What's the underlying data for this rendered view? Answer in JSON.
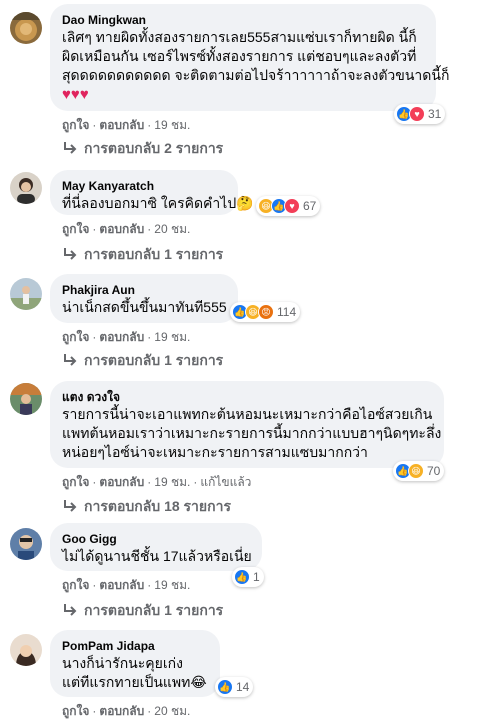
{
  "comments": [
    {
      "author": "Dao Mingkwan",
      "lines": [
        "เลิศๆ ทายผิดทั้งสองรายการเลย555สามแซ่บเราก็ทายผิด นี้ก็",
        "ผิดเหมือนกัน เซอร์ไพรซ์ทั้งสองรายการ แต่ชอบๆและลงตัวที่",
        "สุดดดดดดดดดดด จะติดตามต่อไปจร้าาาาาาถ้าจะลงตัวขนาดนี้ก็"
      ],
      "hearts": "♥♥♥",
      "reaction_count": "31",
      "reaction_icons": [
        "like-icon",
        "love-icon"
      ],
      "like": "ถูกใจ",
      "reply": "ตอบกลับ",
      "time": "19 ชม.",
      "edited": "",
      "replies": "การตอบกลับ 2 รายการ"
    },
    {
      "author": "May Kanyaratch",
      "lines": [
        "ที่นี่ลองบอกมาซิ ใครคิดคำไป🤔"
      ],
      "reaction_count": "67",
      "reaction_icons": [
        "haha-icon",
        "like-icon",
        "love-icon"
      ],
      "like": "ถูกใจ",
      "reply": "ตอบกลับ",
      "time": "20 ชม.",
      "replies": "การตอบกลับ 1 รายการ"
    },
    {
      "author": "Phakjira Aun",
      "lines": [
        "น่าเน็กสดขึ้นขึ้นมาทันที555"
      ],
      "reaction_count": "114",
      "reaction_icons": [
        "like-icon",
        "haha-icon",
        "angry-icon"
      ],
      "like": "ถูกใจ",
      "reply": "ตอบกลับ",
      "time": "19 ชม.",
      "replies": "การตอบกลับ 1 รายการ"
    },
    {
      "author": "แตง ดวงใจ",
      "lines": [
        "รายการนี้น่าจะเอาแพทกะต้นหอมนะเหมาะกว่าคือไอซ์สวยเกิน",
        "แพทต้นหอมเราว่าเหมาะกะรายการนี้มากกว่าแบบฮาๆนิดๆทะลึ่ง",
        "หน่อยๆไอซ์น่าจะเหมาะกะรายการสามแซบมากกว่า"
      ],
      "reaction_count": "70",
      "reaction_icons": [
        "like-icon",
        "haha-icon"
      ],
      "like": "ถูกใจ",
      "reply": "ตอบกลับ",
      "time": "19 ชม.",
      "edited": "แก้ไขแล้ว",
      "replies": "การตอบกลับ 18 รายการ"
    },
    {
      "author": "Goo Gigg",
      "lines": [
        "ไม่ได้ดูนานชีชั้น 17แล้วหรือเนี่ย"
      ],
      "reaction_count": "1",
      "reaction_icons": [
        "like-icon"
      ],
      "like": "ถูกใจ",
      "reply": "ตอบกลับ",
      "time": "19 ชม.",
      "replies": "การตอบกลับ 1 รายการ"
    },
    {
      "author": "PomPam Jidapa",
      "lines": [
        "นางก็น่ารักนะคุยเก่ง",
        "แต่ทีแรกทายเป็นแพท😂"
      ],
      "reaction_count": "14",
      "reaction_icons": [
        "like-icon"
      ],
      "like": "ถูกใจ",
      "reply": "ตอบกลับ",
      "time": "20 ชม."
    }
  ],
  "colors": {
    "bubble": "#f0f2f5",
    "meta_text": "#65676b",
    "like_blue": "#1877f2",
    "love_red": "#f33e58",
    "haha_yellow": "#f7b125",
    "angry_orange": "#e9710f"
  }
}
